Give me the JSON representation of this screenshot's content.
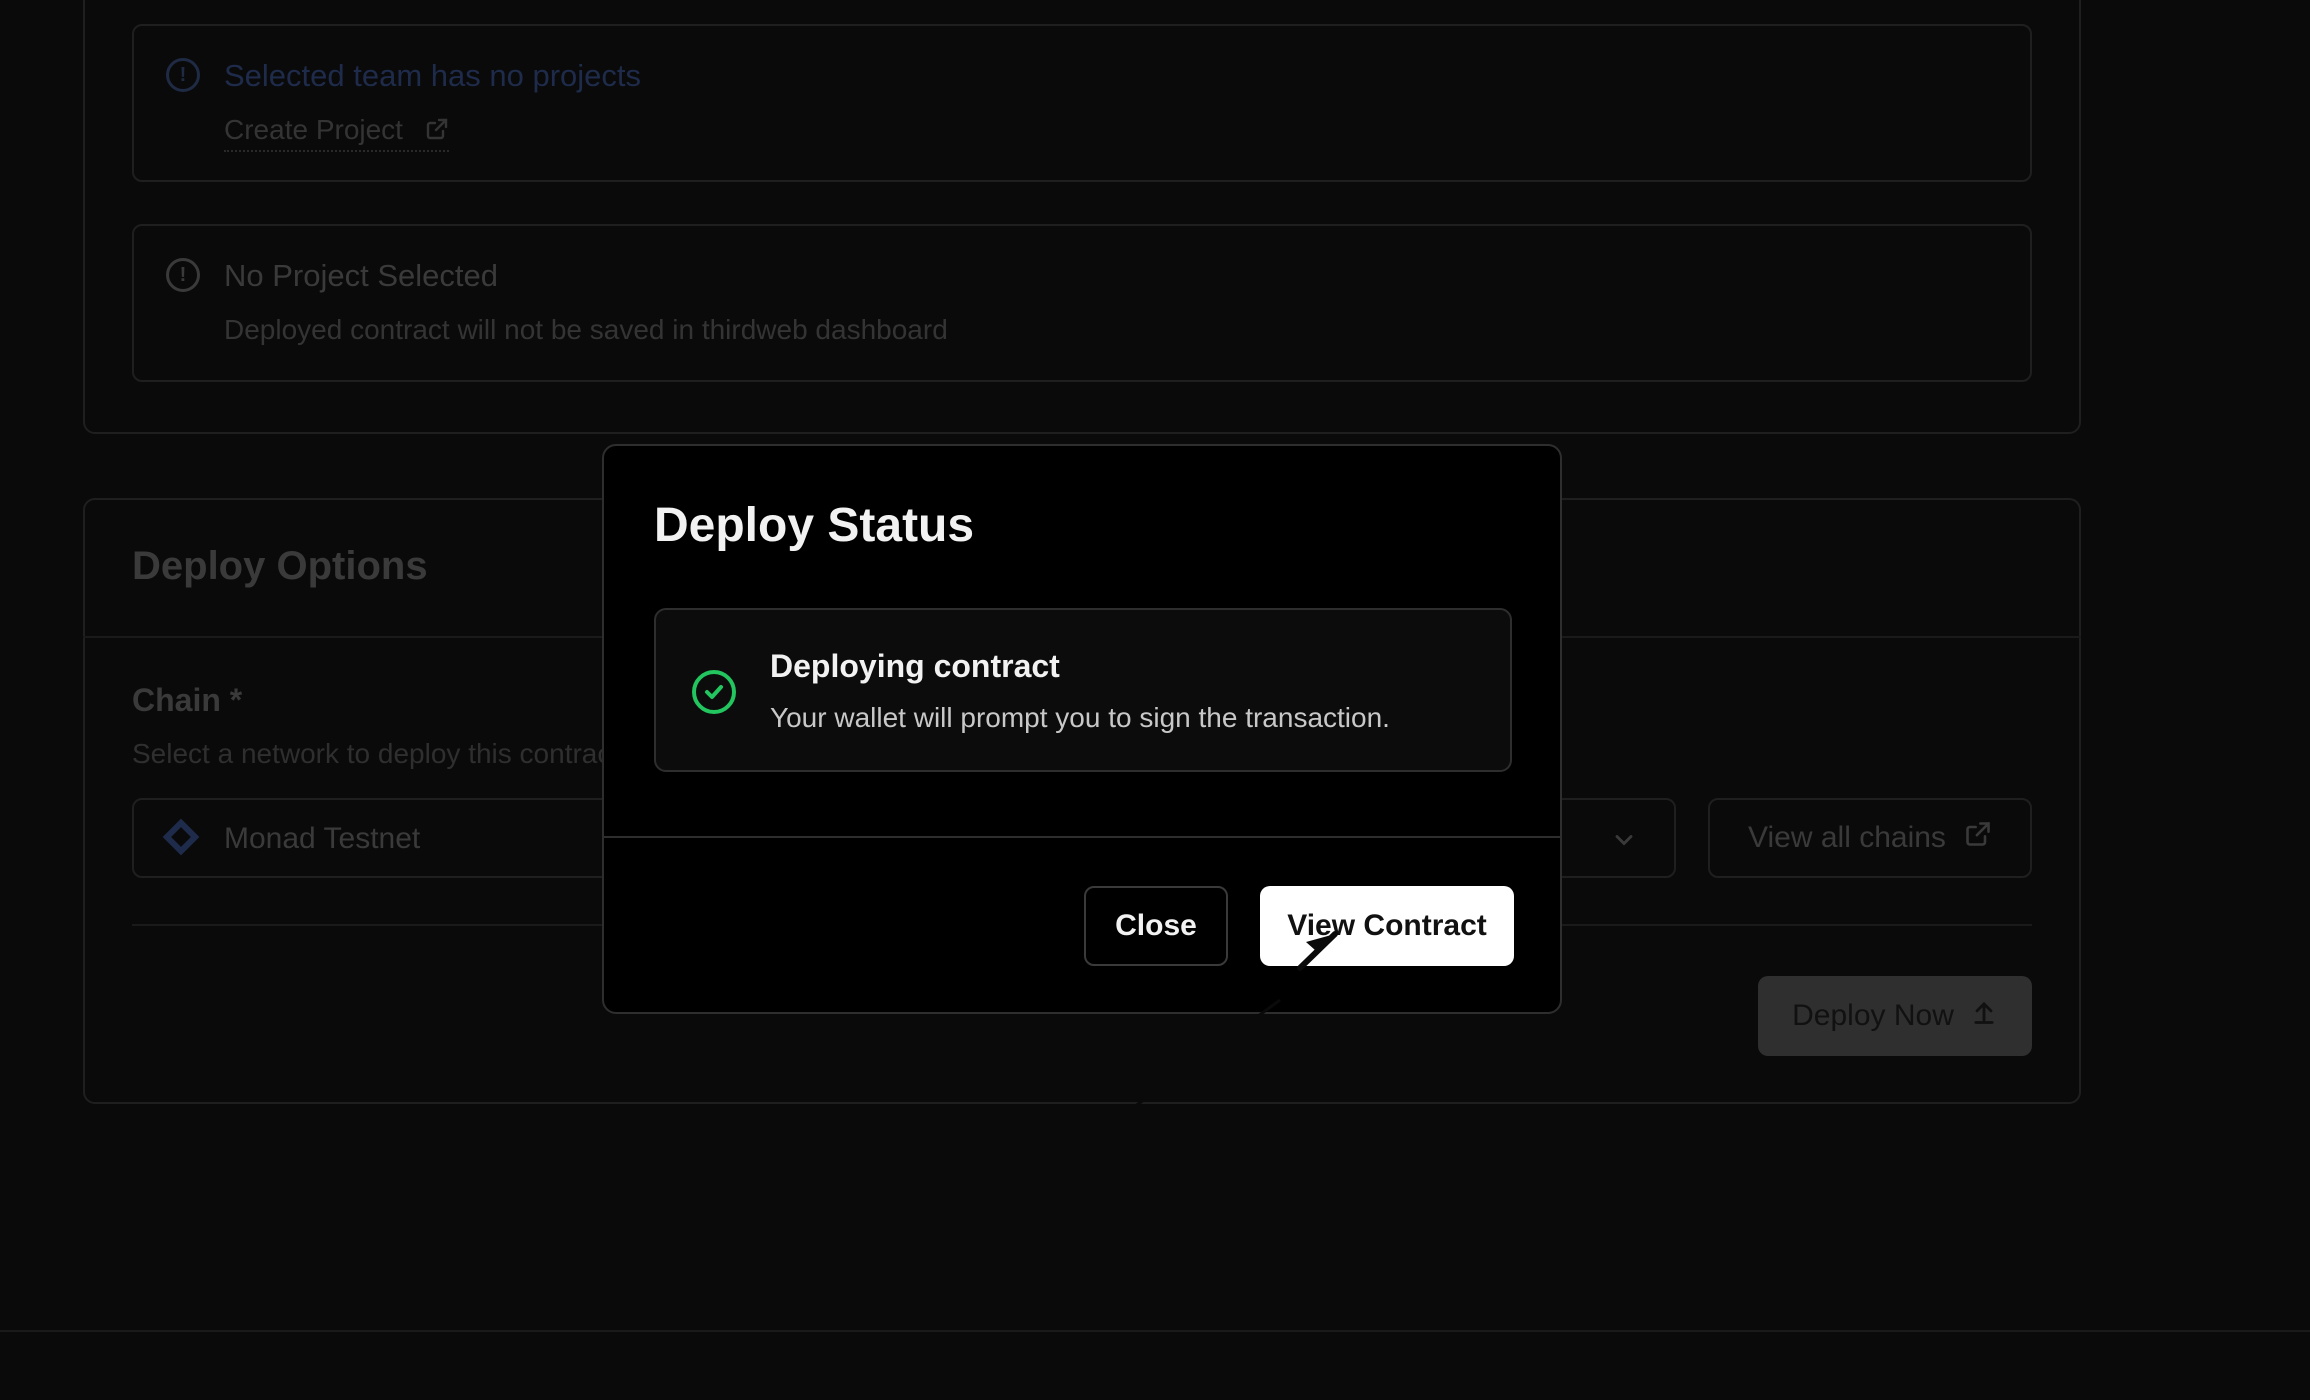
{
  "background": {
    "alerts": [
      {
        "title": "Selected team has no projects",
        "subtitle": "Create Project"
      },
      {
        "title": "No Project Selected",
        "subtitle": "Deployed contract will not be saved in thirdweb dashboard"
      }
    ],
    "deploy_options": {
      "title": "Deploy Options",
      "chain_label": "Chain *",
      "chain_help": "Select a network to deploy this contract",
      "selected_chain": "Monad Testnet",
      "view_all_chains": "View all chains",
      "deploy_now": "Deploy Now"
    }
  },
  "modal": {
    "title": "Deploy Status",
    "status": {
      "title": "Deploying contract",
      "subtitle": "Your wallet will prompt you to sign the transaction."
    },
    "close_label": "Close",
    "view_contract_label": "View Contract"
  },
  "colors": {
    "success": "#22c55e",
    "modal_bg": "#000000",
    "primary_button": "#ffffff"
  }
}
